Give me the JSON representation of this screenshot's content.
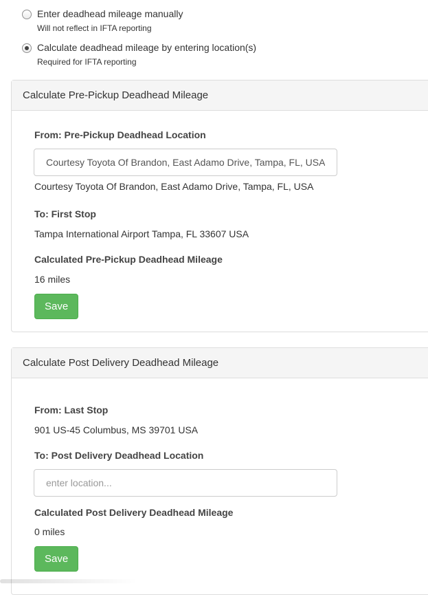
{
  "mode_options": [
    {
      "label": "Enter deadhead mileage manually",
      "help": "Will not reflect in IFTA reporting",
      "checked": false
    },
    {
      "label": "Calculate deadhead mileage by entering location(s)",
      "help": "Required for IFTA reporting",
      "checked": true
    }
  ],
  "pre_pickup": {
    "title": "Calculate Pre-Pickup Deadhead Mileage",
    "from_label": "From: Pre-Pickup Deadhead Location",
    "from_input_value": "Courtesy Toyota Of Brandon, East Adamo Drive, Tampa, FL, USA",
    "from_resolved": "Courtesy Toyota Of Brandon, East Adamo Drive, Tampa, FL, USA",
    "to_label": "To: First Stop",
    "to_value": "Tampa International Airport Tampa, FL 33607 USA",
    "calc_label": "Calculated Pre-Pickup Deadhead Mileage",
    "calc_value": "16 miles",
    "save_label": "Save"
  },
  "post_delivery": {
    "title": "Calculate Post Delivery Deadhead Mileage",
    "from_label": "From: Last Stop",
    "from_value": "901 US-45 Columbus, MS 39701 USA",
    "to_label": "To: Post Delivery Deadhead Location",
    "to_input_value": "",
    "to_input_placeholder": "enter location...",
    "calc_label": "Calculated Post Delivery Deadhead Mileage",
    "calc_value": "0 miles",
    "save_label": "Save"
  },
  "colors": {
    "save_button": "#5cb85c",
    "panel_heading_bg": "#f5f5f5",
    "panel_border": "#dddddd"
  }
}
